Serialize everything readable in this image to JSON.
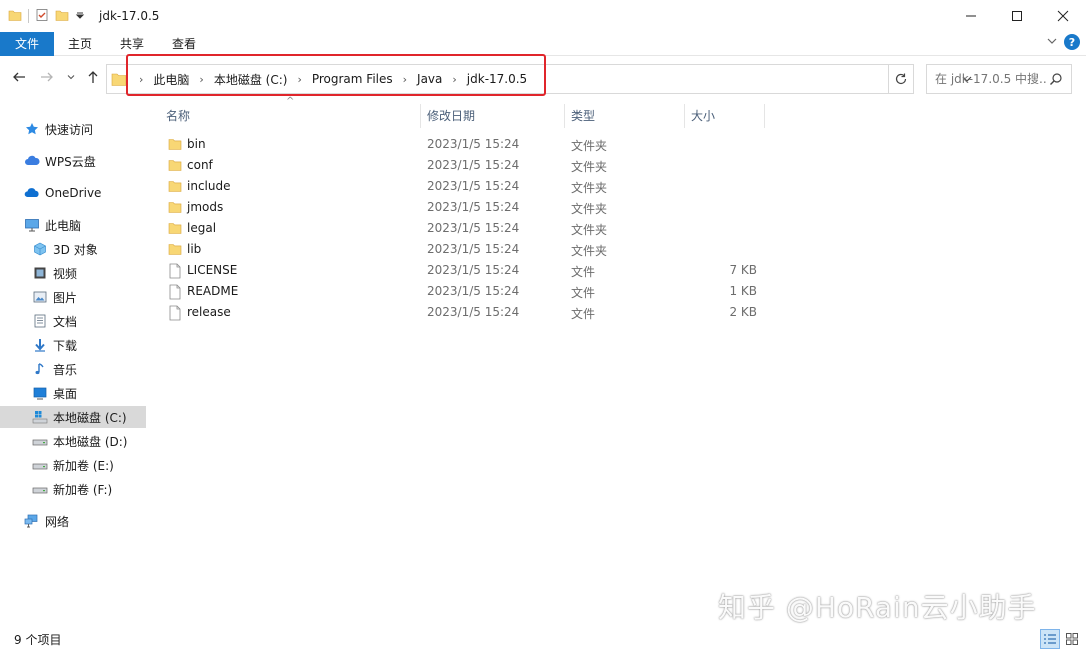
{
  "window": {
    "title": "jdk-17.0.5"
  },
  "ribbon": {
    "tabs": [
      "文件",
      "主页",
      "共享",
      "查看"
    ]
  },
  "address": {
    "crumbs": [
      "此电脑",
      "本地磁盘 (C:)",
      "Program Files",
      "Java",
      "jdk-17.0.5"
    ]
  },
  "search": {
    "placeholder": "在 jdk-17.0.5 中搜..."
  },
  "sidebar": {
    "items": [
      {
        "label": "快速访问",
        "icon": "star-icon"
      },
      {
        "label": "WPS云盘",
        "icon": "cloud-icon"
      },
      {
        "label": "OneDrive",
        "icon": "onedrive-icon"
      },
      {
        "label": "此电脑",
        "icon": "computer-icon"
      },
      {
        "label": "3D 对象",
        "icon": "cube-icon"
      },
      {
        "label": "视频",
        "icon": "video-icon"
      },
      {
        "label": "图片",
        "icon": "picture-icon"
      },
      {
        "label": "文档",
        "icon": "document-icon"
      },
      {
        "label": "下载",
        "icon": "download-icon"
      },
      {
        "label": "音乐",
        "icon": "music-icon"
      },
      {
        "label": "桌面",
        "icon": "desktop-icon"
      },
      {
        "label": "本地磁盘 (C:)",
        "icon": "drive-c-icon"
      },
      {
        "label": "本地磁盘 (D:)",
        "icon": "drive-icon"
      },
      {
        "label": "新加卷 (E:)",
        "icon": "drive-icon"
      },
      {
        "label": "新加卷 (F:)",
        "icon": "drive-icon"
      },
      {
        "label": "网络",
        "icon": "network-icon"
      }
    ]
  },
  "columns": {
    "name": "名称",
    "date": "修改日期",
    "type": "类型",
    "size": "大小"
  },
  "files": [
    {
      "name": "bin",
      "date": "2023/1/5 15:24",
      "type": "文件夹",
      "size": "",
      "kind": "folder"
    },
    {
      "name": "conf",
      "date": "2023/1/5 15:24",
      "type": "文件夹",
      "size": "",
      "kind": "folder"
    },
    {
      "name": "include",
      "date": "2023/1/5 15:24",
      "type": "文件夹",
      "size": "",
      "kind": "folder"
    },
    {
      "name": "jmods",
      "date": "2023/1/5 15:24",
      "type": "文件夹",
      "size": "",
      "kind": "folder"
    },
    {
      "name": "legal",
      "date": "2023/1/5 15:24",
      "type": "文件夹",
      "size": "",
      "kind": "folder"
    },
    {
      "name": "lib",
      "date": "2023/1/5 15:24",
      "type": "文件夹",
      "size": "",
      "kind": "folder"
    },
    {
      "name": "LICENSE",
      "date": "2023/1/5 15:24",
      "type": "文件",
      "size": "7 KB",
      "kind": "file"
    },
    {
      "name": "README",
      "date": "2023/1/5 15:24",
      "type": "文件",
      "size": "1 KB",
      "kind": "file"
    },
    {
      "name": "release",
      "date": "2023/1/5 15:24",
      "type": "文件",
      "size": "2 KB",
      "kind": "file"
    }
  ],
  "status": {
    "count": "9 个项目"
  },
  "watermark": "知乎 @HoRain云小助手",
  "colors": {
    "accent": "#1979ca",
    "folder": "#f8d775",
    "highlight": "#e0252b",
    "selected": "#d9d9d9"
  }
}
